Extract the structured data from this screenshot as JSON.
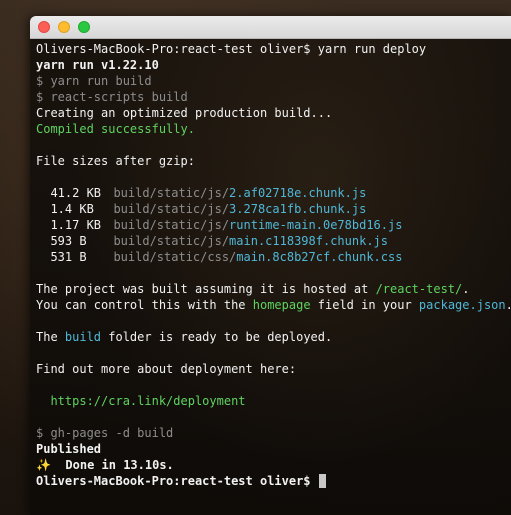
{
  "terminal": {
    "prompt_cmd": "Olivers-MacBook-Pro:react-test oliver$ yarn run deploy",
    "yarn_version": "yarn run v1.22.10",
    "cmd_build": "$ yarn run build",
    "cmd_react_scripts": "$ react-scripts build",
    "creating": "Creating an optimized production build...",
    "compiled": "Compiled successfully.",
    "file_sizes_header": "File sizes after gzip:",
    "files": [
      {
        "size": "41.2 KB",
        "dir": "build/static/js/",
        "name": "2.af02718e.chunk.js"
      },
      {
        "size": "1.4 KB",
        "dir": "build/static/js/",
        "name": "3.278ca1fb.chunk.js"
      },
      {
        "size": "1.17 KB",
        "dir": "build/static/js/",
        "name": "runtime-main.0e78bd16.js"
      },
      {
        "size": "593 B",
        "dir": "build/static/js/",
        "name": "main.c118398f.chunk.js"
      },
      {
        "size": "531 B",
        "dir": "build/static/css/",
        "name": "main.8c8b27cf.chunk.css"
      }
    ],
    "hosted_pre": "The project was built assuming it is hosted at ",
    "hosted_path": "/react-test/",
    "hosted_post": ".",
    "control_pre": "You can control this with the ",
    "control_homepage": "homepage",
    "control_mid": " field in your ",
    "control_package": "package.json",
    "control_post": ".",
    "ready_pre": "The ",
    "ready_build": "build",
    "ready_post": " folder is ready to be deployed.",
    "find_out": "Find out more about deployment here:",
    "deploy_url": "https://cra.link/deployment",
    "cmd_gh_pages": "$ gh-pages -d build",
    "published": "Published",
    "sparkle": "✨",
    "done": "  Done in 13.10s.",
    "final_prompt": "Olivers-MacBook-Pro:react-test oliver$ "
  }
}
